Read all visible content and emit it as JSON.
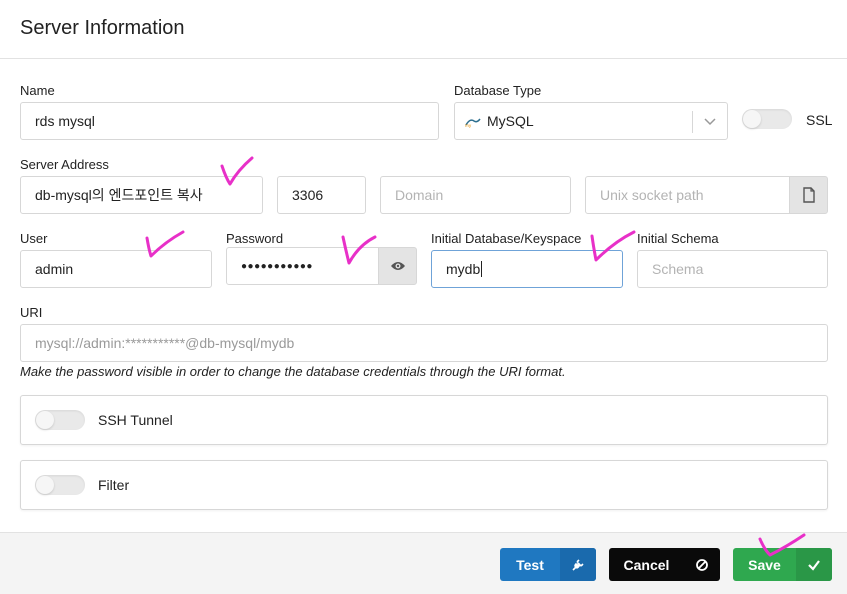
{
  "title": "Server Information",
  "fields": {
    "name": {
      "label": "Name",
      "value": "rds mysql"
    },
    "db_type": {
      "label": "Database Type",
      "value": "MySQL"
    },
    "ssl": {
      "label": "SSL"
    },
    "server_address": {
      "label": "Server Address",
      "value": "db-mysql의 엔드포인트 복사"
    },
    "port": {
      "value": "3306"
    },
    "domain": {
      "placeholder": "Domain"
    },
    "socket": {
      "placeholder": "Unix socket path"
    },
    "user": {
      "label": "User",
      "value": "admin"
    },
    "password": {
      "label": "Password",
      "value": "●●●●●●●●●●●"
    },
    "initial_db": {
      "label": "Initial Database/Keyspace",
      "value": "mydb"
    },
    "initial_schema": {
      "label": "Initial Schema",
      "placeholder": "Schema"
    },
    "uri": {
      "label": "URI",
      "value": "mysql://admin:***********@db-mysql/mydb"
    }
  },
  "hint": "Make the password visible in order to change the database credentials through the URI format.",
  "panels": {
    "ssh": "SSH Tunnel",
    "filter": "Filter"
  },
  "buttons": {
    "test": "Test",
    "cancel": "Cancel",
    "save": "Save"
  },
  "colors": {
    "test": "#1f78c1",
    "cancel": "#0a0a0a",
    "save": "#2fa84f",
    "annotation": "#e830c8"
  }
}
